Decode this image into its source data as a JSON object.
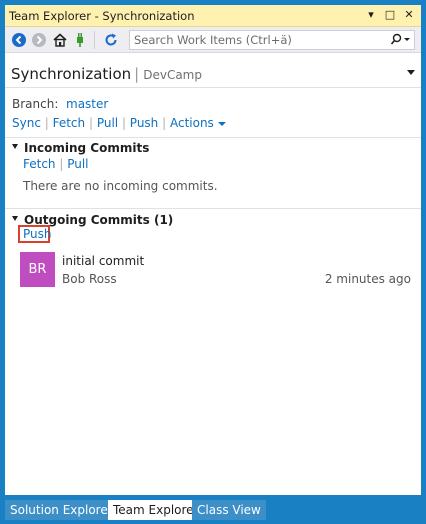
{
  "window": {
    "title": "Team Explorer - Synchronization"
  },
  "titlebar_buttons": [
    {
      "name": "dropdown-icon",
      "glyph": "▾"
    },
    {
      "name": "pin-icon",
      "glyph": "□"
    },
    {
      "name": "close-icon",
      "glyph": "✕"
    }
  ],
  "search": {
    "placeholder": "Search Work Items (Ctrl+ä)"
  },
  "page": {
    "title": "Synchronization",
    "project": "DevCamp"
  },
  "branch": {
    "label": "Branch:",
    "name": "master"
  },
  "actions": {
    "sync": "Sync",
    "fetch": "Fetch",
    "pull": "Pull",
    "push": "Push",
    "more": "Actions"
  },
  "incoming": {
    "title": "Incoming Commits",
    "fetch": "Fetch",
    "pull": "Pull",
    "empty": "There are no incoming commits."
  },
  "outgoing": {
    "title": "Outgoing Commits (1)",
    "push": "Push"
  },
  "commit": {
    "initials": "BR",
    "message": "initial commit",
    "author": "Bob Ross",
    "time": "2 minutes ago",
    "avatar_color": "#c04dc0"
  },
  "tabs": [
    "Solution Explorer",
    "Team Explorer",
    "Class View"
  ],
  "colors": {
    "accent": "#1a80c4",
    "link": "#0e70c0",
    "highlight": "#d9412c",
    "titlebar": "#fff1b0"
  }
}
